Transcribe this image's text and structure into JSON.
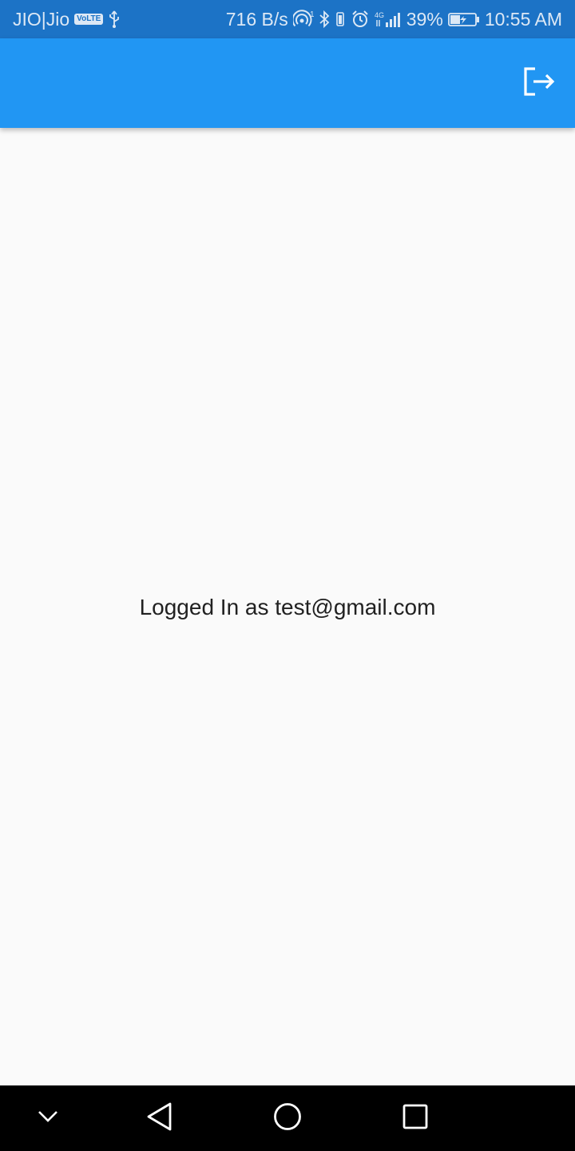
{
  "status_bar": {
    "carrier": "JIO|Jio",
    "volte": "VoLTE",
    "net_speed": "716 B/s",
    "hotspot_sup": "1",
    "net_type": "4G",
    "battery_percent": "39%",
    "time": "10:55 AM",
    "icons": [
      "usb-icon",
      "hotspot-icon",
      "bluetooth-icon",
      "vibrate-icon",
      "alarm-icon",
      "signal-icon",
      "battery-icon"
    ]
  },
  "app_bar": {
    "color": "#2196f3",
    "actions": [
      "logout-icon"
    ]
  },
  "main": {
    "message": "Logged In as test@gmail.com"
  },
  "nav_bar": {
    "buttons": [
      "collapse-icon",
      "back-icon",
      "home-icon",
      "recents-icon"
    ]
  }
}
